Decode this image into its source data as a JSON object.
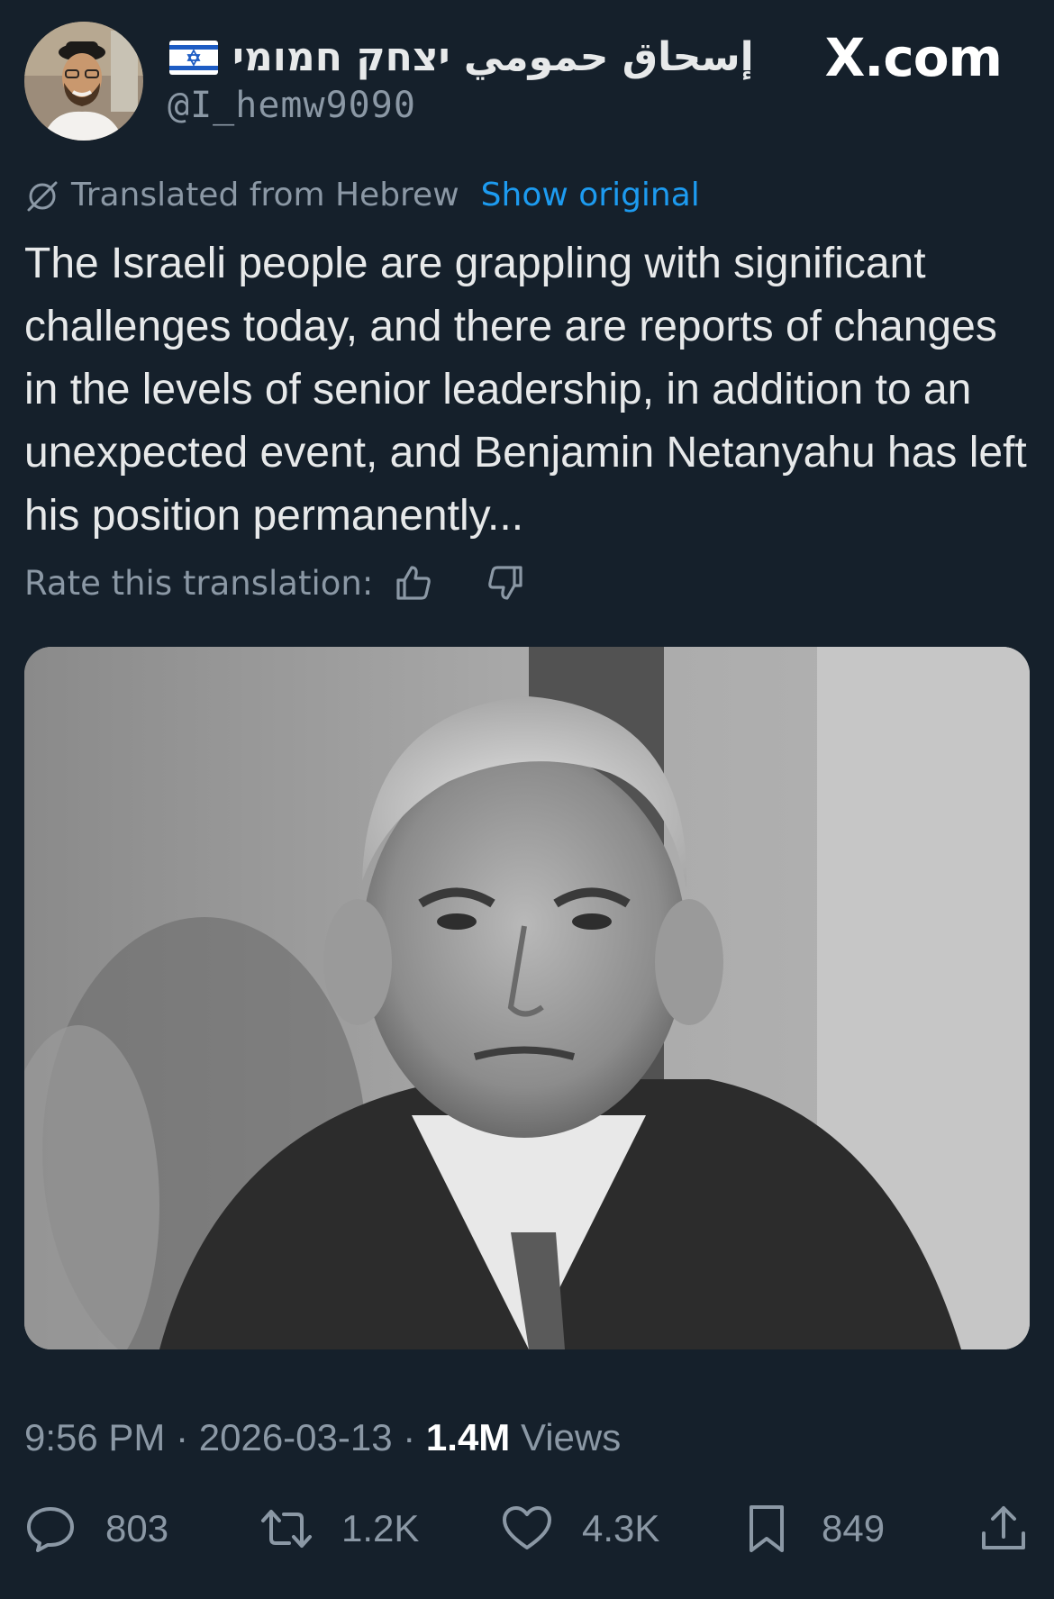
{
  "header": {
    "display_name": "إسحاق حمومي יצחק חמומי",
    "handle": "@I_hemw9090",
    "flag": "israel-flag-icon",
    "site_logo": "X.com",
    "avatar": "profile-avatar"
  },
  "translation": {
    "translated_label": "Translated from Hebrew",
    "show_original_label": "Show original",
    "rate_label": "Rate this translation:"
  },
  "tweet": {
    "text": "The Israeli people are grappling with significant challenges today, and there are reports of changes in the levels of senior leadership, in addition to an unexpected event, and Benjamin Netanyahu has left his position permanently...",
    "image": "black-and-white-portrait-photo"
  },
  "meta": {
    "time": "9:56 PM",
    "separator": " · ",
    "date": "2026-03-13",
    "views_count": "1.4M",
    "views_label": "Views"
  },
  "actions": {
    "reply_count": "803",
    "retweet_count": "1.2K",
    "like_count": "4.3K",
    "bookmark_count": "849"
  },
  "colors": {
    "background": "#15202b",
    "text_primary": "#e7e9ea",
    "text_secondary": "#8b98a5",
    "accent": "#1d9bf0"
  }
}
